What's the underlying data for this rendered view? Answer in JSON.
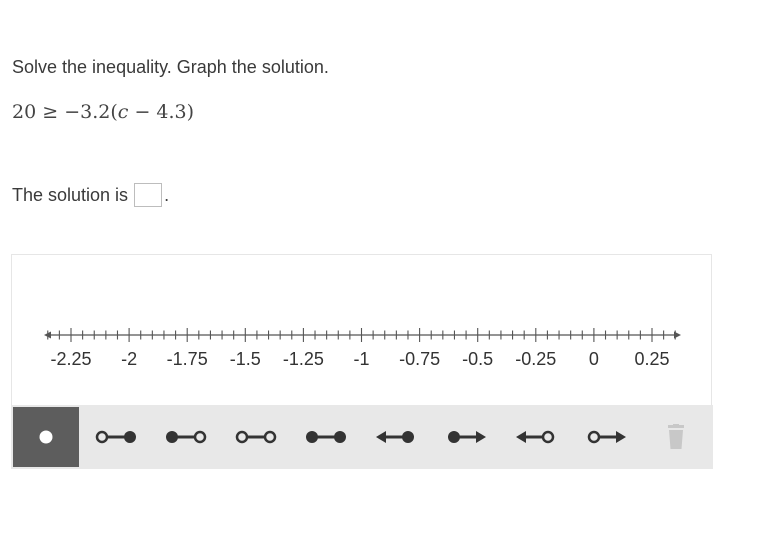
{
  "prompt": "Solve the inequality. Graph the solution.",
  "equation": {
    "lhs": "20",
    "op": "≥",
    "rhs_coef": "−3.2(",
    "var": "c",
    "rhs_rest": " − 4.3)"
  },
  "solution": {
    "prefix": "The solution is",
    "suffix": ".",
    "value": ""
  },
  "number_line": {
    "min": -2.25,
    "max": 0.25,
    "minor_step": 0.05,
    "major_step": 0.25,
    "labels": [
      "-2.25",
      "-2",
      "-1.75",
      "-1.5",
      "-1.25",
      "-1",
      "-0.75",
      "-0.5",
      "-0.25",
      "0",
      "0.25"
    ]
  },
  "toolbar": {
    "selected": "point",
    "tools": [
      {
        "name": "point-tool",
        "icon": "closed-point"
      },
      {
        "name": "open-closed-segment-tool",
        "icon": "open-closed-segment"
      },
      {
        "name": "closed-open-segment-tool",
        "icon": "closed-open-segment"
      },
      {
        "name": "open-segment-tool",
        "icon": "open-open-segment"
      },
      {
        "name": "closed-segment-tool",
        "icon": "closed-closed-segment"
      },
      {
        "name": "left-ray-closed-tool",
        "icon": "left-arrow-closed-point"
      },
      {
        "name": "right-ray-closed-tool",
        "icon": "closed-point-right-arrow"
      },
      {
        "name": "left-ray-open-tool",
        "icon": "left-arrow-open-point"
      },
      {
        "name": "right-ray-open-tool",
        "icon": "open-point-right-arrow"
      },
      {
        "name": "delete-tool",
        "icon": "trash-icon"
      }
    ],
    "colors": {
      "icon": "#333333",
      "selected_bg": "#5d5d5d",
      "bar_bg": "#e8e8e8",
      "disabled": "#c8c8c8"
    }
  }
}
